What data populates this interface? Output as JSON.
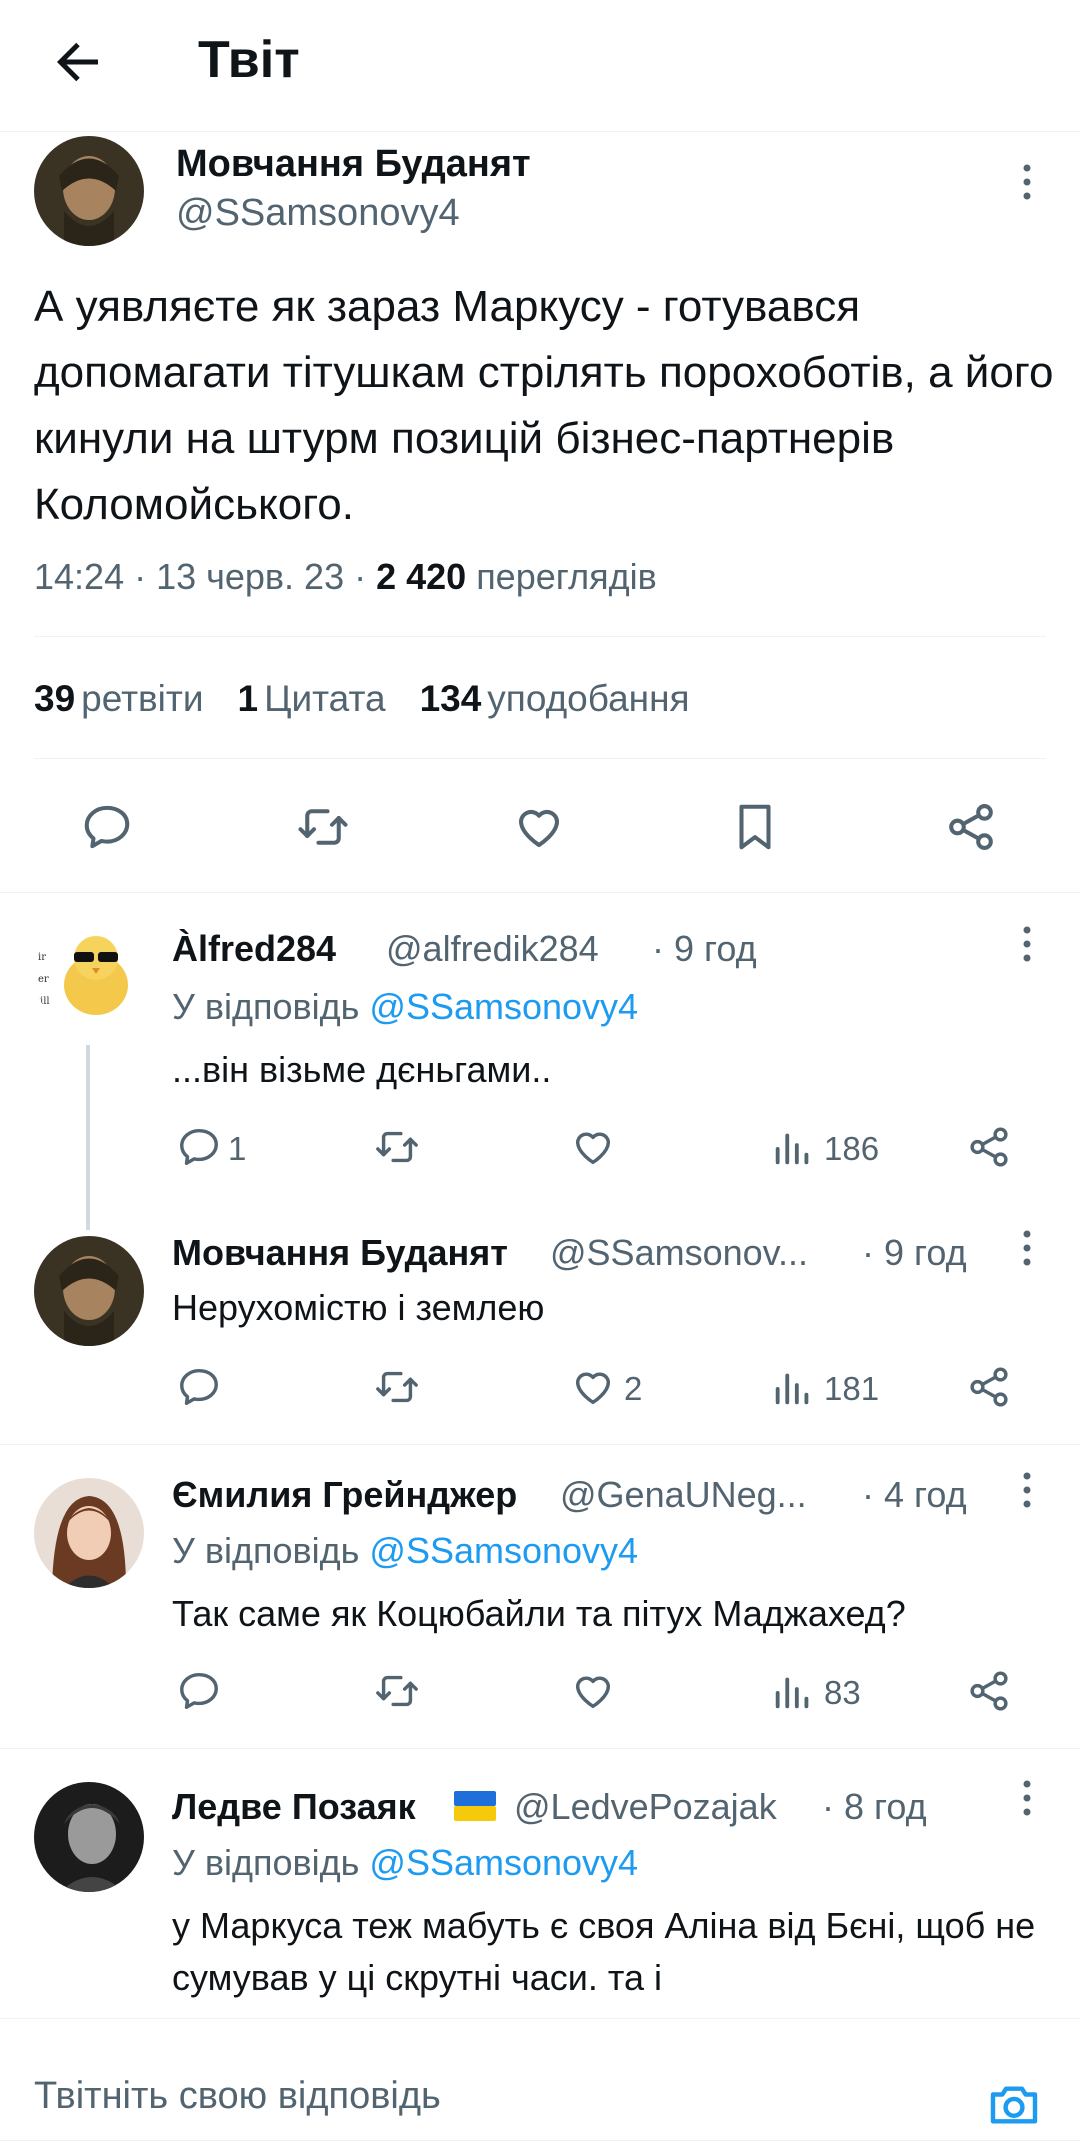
{
  "header": {
    "title": "Твіт"
  },
  "main_tweet": {
    "author_name": "Мовчання Буданят",
    "author_handle": "@SSamsonovy4",
    "text": "А уявляєте як зараз Маркусу - готувався допомагати тітушкам стрілять порохоботів, а його кинули на штурм позицій бізнес-партнерів Коломойського.",
    "time": "14:24 · 13 черв. 23 · ",
    "views_count": "2 420",
    "views_label": " переглядів",
    "retweets_count": "39",
    "retweets_label": "ретвіти",
    "quotes_count": "1",
    "quotes_label": "Цитата",
    "likes_count": "134",
    "likes_label": "уподобання"
  },
  "replies": [
    {
      "name": "Àlfred284",
      "handle": "@alfredik284",
      "time": "· 9 год",
      "reply_prefix": "У відповідь ",
      "reply_to": "@SSamsonovy4",
      "text": "...він візьме дєньгами..",
      "replies_count": "1",
      "likes_count": "",
      "views_count": "186"
    },
    {
      "name": "Мовчання Буданят",
      "handle": "@SSamsonov...",
      "time": "· 9 год",
      "text": "Нерухомістю і землею",
      "replies_count": "",
      "likes_count": "2",
      "views_count": "181"
    },
    {
      "name": "Ємилия Грейнджер",
      "handle": "@GenaUNeg...",
      "time": "· 4 год",
      "reply_prefix": "У відповідь ",
      "reply_to": "@SSamsonovy4",
      "text": "Так саме як Коцюбайли та пітух Маджахед?",
      "replies_count": "",
      "likes_count": "",
      "views_count": "83"
    },
    {
      "name": "Ледве Позаяк",
      "handle": "@LedvePozajak",
      "time": "· 8 год",
      "reply_prefix": "У відповідь ",
      "reply_to": "@SSamsonovy4",
      "text": "у Маркуса теж мабуть є своя Аліна від Бєні, щоб не сумував у ці скрутні часи. та і"
    }
  ],
  "compose": {
    "placeholder": "Твітніть свою відповідь"
  },
  "colors": {
    "accent": "#1d9bf0",
    "text": "#0f1419",
    "muted": "#536471",
    "border": "#eff3f4"
  }
}
